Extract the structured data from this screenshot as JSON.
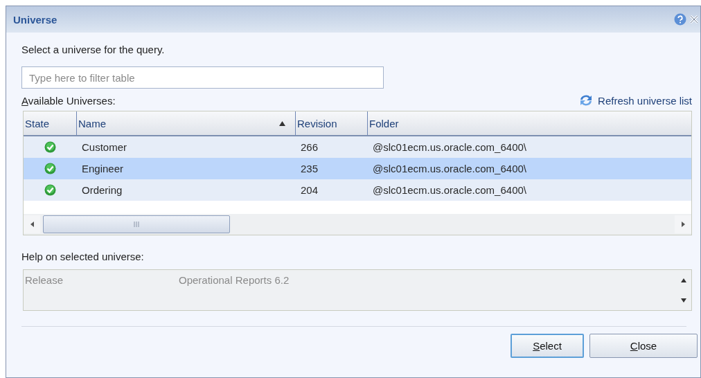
{
  "window": {
    "title": "Universe"
  },
  "prompt": "Select a universe for the query.",
  "filter": {
    "placeholder": "Type here to filter table"
  },
  "list_label": "Available Universes:",
  "refresh_link": "Refresh universe list",
  "table": {
    "columns": [
      {
        "label": "State",
        "sorted": false
      },
      {
        "label": "Name",
        "sorted": true
      },
      {
        "label": "Revision",
        "sorted": false
      },
      {
        "label": "Folder",
        "sorted": false
      }
    ],
    "rows": [
      {
        "valid": true,
        "name": "Customer",
        "revision": "266",
        "folder": "@slc01ecm.us.oracle.com_6400\\",
        "selected": false
      },
      {
        "valid": true,
        "name": "Engineer",
        "revision": "235",
        "folder": "@slc01ecm.us.oracle.com_6400\\",
        "selected": true
      },
      {
        "valid": true,
        "name": "Ordering",
        "revision": "204",
        "folder": "@slc01ecm.us.oracle.com_6400\\",
        "selected": false
      }
    ]
  },
  "help_label": "Help on selected universe:",
  "help": {
    "key": "Release",
    "value": "Operational Reports 6.2"
  },
  "buttons": [
    {
      "label": "Select",
      "default": true
    },
    {
      "label": "Close",
      "default": false
    }
  ]
}
